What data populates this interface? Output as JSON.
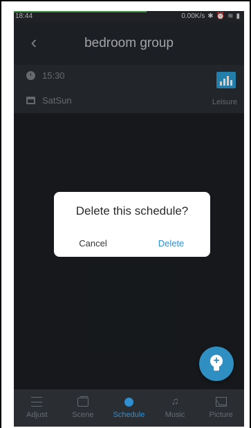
{
  "statusbar": {
    "time": "18:44",
    "network_speed": "0.00K/s",
    "icons": [
      "bluetooth-icon",
      "alarm-icon",
      "wifi-icon",
      "signal-icon"
    ],
    "load_color": "#4caf50"
  },
  "header": {
    "title": "bedroom group",
    "back_icon": "chevron-left-icon"
  },
  "schedule": {
    "time": "15:30",
    "days": "SatSun",
    "scene_label": "Leisure",
    "scene_icon": "bar-chart-icon",
    "accent": "#2d9ad0"
  },
  "dialog": {
    "title": "Delete this schedule?",
    "cancel_label": "Cancel",
    "delete_label": "Delete"
  },
  "fab": {
    "icon": "add-light-icon",
    "plus": "+"
  },
  "bottom_nav": {
    "items": [
      {
        "label": "Adjust",
        "icon": "sliders-icon"
      },
      {
        "label": "Scene",
        "icon": "clapperboard-icon"
      },
      {
        "label": "Schedule",
        "icon": "clock-icon",
        "active": true
      },
      {
        "label": "Music",
        "icon": "music-note-icon"
      },
      {
        "label": "Picture",
        "icon": "image-icon"
      }
    ]
  }
}
